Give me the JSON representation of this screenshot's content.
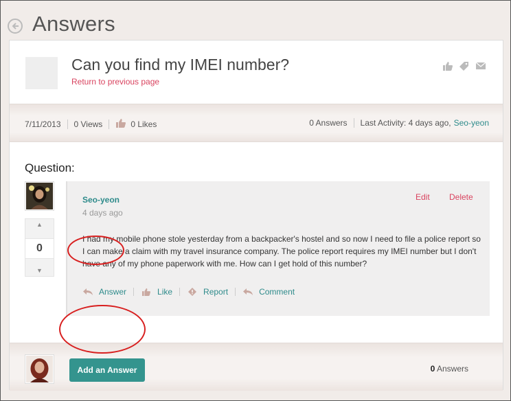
{
  "header": {
    "title": "Answers"
  },
  "question": {
    "title": "Can you find my IMEI number?",
    "return_link": "Return to previous page"
  },
  "meta": {
    "date": "7/11/2013",
    "views": "0 Views",
    "likes": "0 Likes",
    "answers": "0 Answers",
    "last_activity": "Last Activity: 4 days ago,",
    "last_user": "Seo-yeon"
  },
  "section": {
    "label": "Question:"
  },
  "vote": {
    "up": "▲",
    "count": "0",
    "down": "▼"
  },
  "post": {
    "author": "Seo-yeon",
    "time": "4 days ago",
    "edit": "Edit",
    "delete": "Delete",
    "body": "I had my mobile phone stole yesterday from a backpacker's hostel and so now I need to file a police report so I can make a claim with my travel insurance company. The police report requires my IMEI number but I don't have any of my phone paperwork with me. How can I get hold of this number?",
    "actions": {
      "answer": "Answer",
      "like": "Like",
      "report": "Report",
      "comment": "Comment"
    }
  },
  "footer": {
    "add_answer": "Add an Answer",
    "answers_count": "0",
    "answers_label": "Answers"
  },
  "colors": {
    "accent": "#34948e",
    "link": "#2e8b8b",
    "danger": "#d9435f",
    "highlight": "#d81f1f"
  }
}
